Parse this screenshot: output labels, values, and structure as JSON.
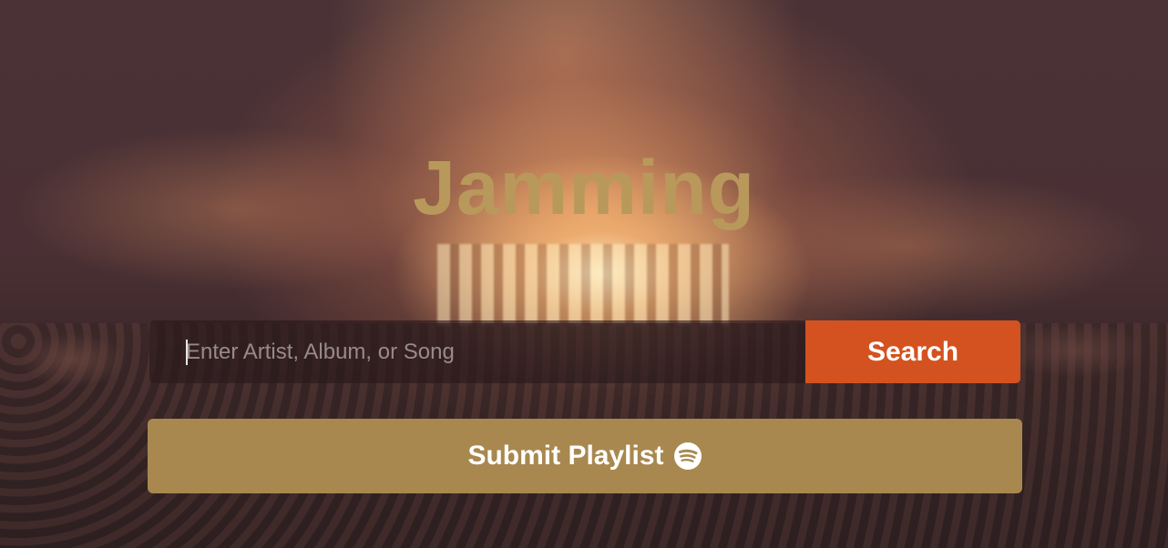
{
  "app": {
    "title": "Jamming"
  },
  "search": {
    "placeholder": "Enter Artist, Album, or Song",
    "value": "",
    "button_label": "Search"
  },
  "playlist": {
    "submit_label": "Submit Playlist",
    "submit_icon": "spotify-icon"
  },
  "colors": {
    "title": "#b8995b",
    "search_button": "#d4521f",
    "submit_button": "#a8884f"
  }
}
